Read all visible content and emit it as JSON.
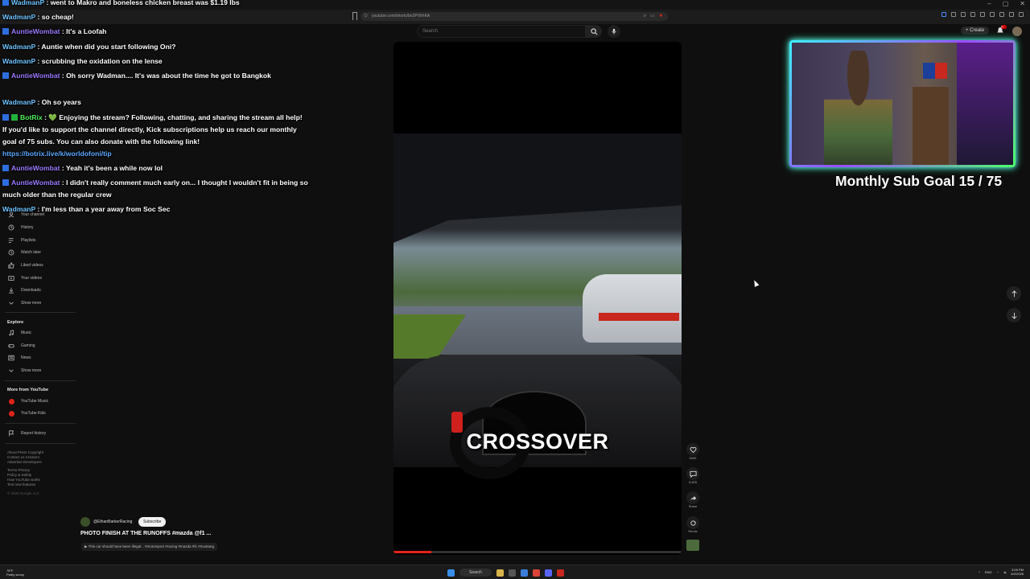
{
  "browser": {
    "url": "youtube.com/shorts/bo2PVlrhKA",
    "window_controls": [
      "–",
      "▢",
      "✕"
    ]
  },
  "youtube": {
    "search_placeholder": "Search",
    "create_label": "+ Create",
    "notification_count": "9+"
  },
  "sidebar": {
    "you_items": [
      "Your channel",
      "History",
      "Playlists",
      "Watch later",
      "Liked videos",
      "Your videos",
      "Downloads",
      "Show more"
    ],
    "explore_heading": "Explore",
    "explore_items": [
      "Music",
      "Gaming",
      "News",
      "Show more"
    ],
    "more_heading": "More from YouTube",
    "more_items": [
      "YouTube Music",
      "YouTube Kids"
    ],
    "report_history": "Report history",
    "footer_lines": [
      "About  Press  Copyright",
      "Contact us  Creators",
      "Advertise  Developers",
      "",
      "Terms  Privacy",
      "Policy & Safety",
      "How YouTube works",
      "Test new features"
    ],
    "copyright": "© 2026 Google LLC"
  },
  "chat": {
    "messages": [
      {
        "user": "WadmanP",
        "text": ": went to Makro and boneless chicken breast was $1.19 lbs",
        "color": "#6ec3ff"
      },
      {
        "user": "WadmanP",
        "text": ": so cheap!",
        "color": "#6ec3ff"
      },
      {
        "user": "AuntieWombat",
        "text": ": It's a Loofah",
        "color": "#9c7bff"
      },
      {
        "user": "WadmanP",
        "text": ": Auntie when did you start following Oni?",
        "color": "#6ec3ff"
      },
      {
        "user": "WadmanP",
        "text": ": scrubbing the oxidation on the lense",
        "color": "#6ec3ff"
      },
      {
        "user": "AuntieWombat",
        "text": ": Oh sorry Wadman.... It's was about the time he got to Bangkok",
        "color": "#9c7bff"
      },
      {
        "user": "WadmanP",
        "text": ": Oh so years",
        "color": "#6ec3ff"
      },
      {
        "user": "BotRix",
        "text": ": 💚 Enjoying the stream? Following, chatting, and sharing the stream all help! If you'd like to support the channel directly, Kick subscriptions help us reach our monthly goal of 75 subs. You can also donate with the following link!",
        "link": "https://botrix.live/k/worldofoni/tip",
        "color": "#52ef5a"
      },
      {
        "user": "AuntieWombat",
        "text": ": Yeah it's been a while now lol",
        "color": "#9c7bff"
      },
      {
        "user": "AuntieWombat",
        "text": ": I didn't really comment much early on... I thought I wouldn't fit in being so much older than the regular crew",
        "color": "#9c7bff"
      },
      {
        "user": "WadmanP",
        "text": ": I'm less than a year away from Soc Sec",
        "color": "#6ec3ff"
      }
    ]
  },
  "short": {
    "caption": "CROSSOVER",
    "progress": 0.13,
    "likes": "284K",
    "comments": "5,825",
    "share": "Share",
    "remix": "Remix",
    "channel": "@EthanBarkerRacing",
    "subscribe": "Subscribe",
    "title": "PHOTO FINISH AT THE RUNOFFS #mazda @f1 ...",
    "description": "▶ This car should have been illegal... #motorsport #racing #mazda #f1 #mustang"
  },
  "stream_overlay": {
    "sub_goal_label": "Monthly Sub Goal 15 / 75",
    "sub_goal_current": 15,
    "sub_goal_target": 75
  },
  "taskbar": {
    "weather_temp": "78°F",
    "weather_desc": "Partly sunny",
    "search_label": "Search",
    "language": "ENG",
    "time": "3:09 PM",
    "date": "6/2/2026"
  }
}
